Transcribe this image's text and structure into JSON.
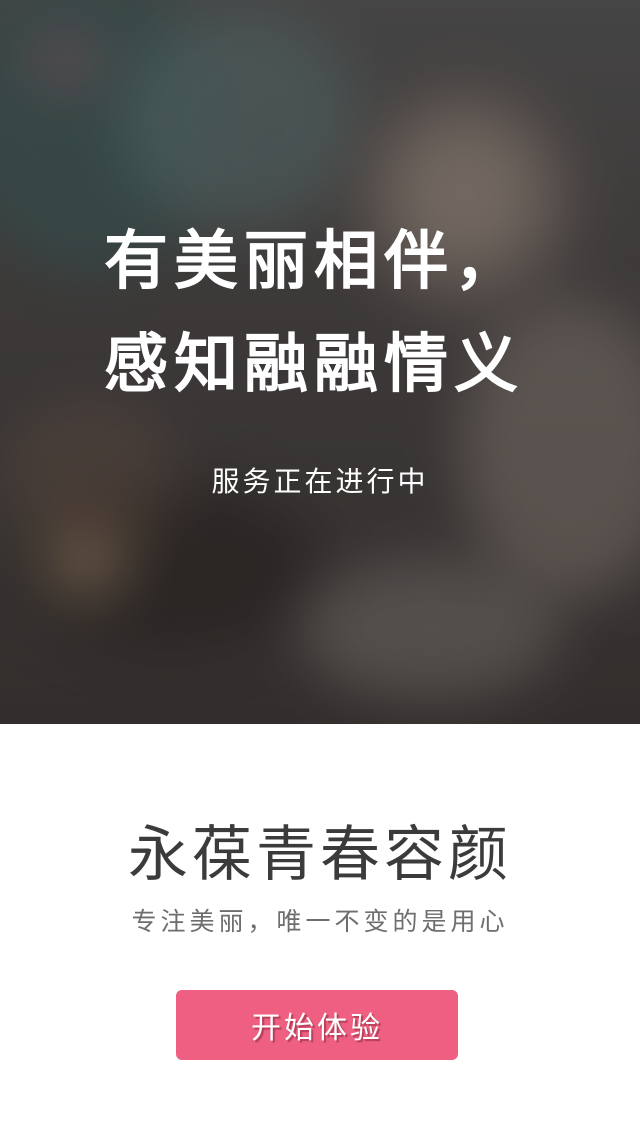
{
  "hero": {
    "headline_line1": "有美丽相伴，",
    "headline_line2": "感知融融情义",
    "status": "服务正在进行中"
  },
  "main": {
    "tagline": "永葆青春容颜",
    "subtagline": "专注美丽，唯一不变的是用心",
    "cta_label": "开始体验"
  },
  "colors": {
    "accent": "#ee5f81",
    "background": "#ffffff",
    "tagline_text": "#3b3b3b",
    "subtagline_text": "#6e6e6e"
  }
}
